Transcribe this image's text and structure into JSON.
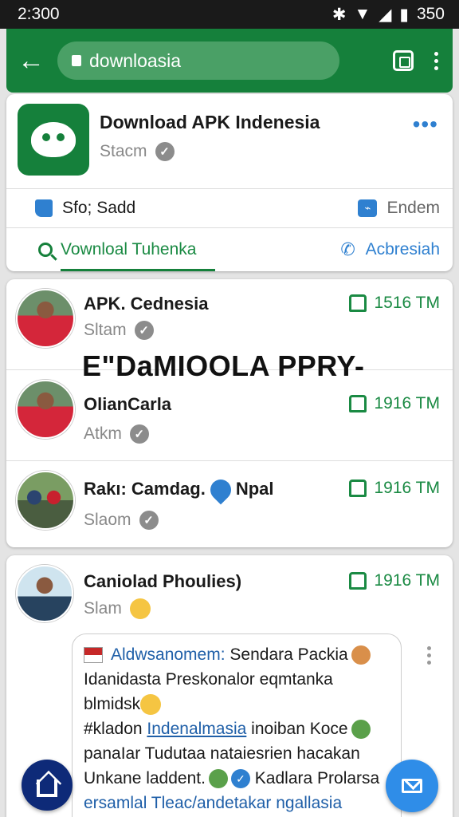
{
  "status_bar": {
    "time": "2:300",
    "battery": "350"
  },
  "browser": {
    "url": "downloasia"
  },
  "app_card": {
    "title": "Download APK Indenesia",
    "subtitle": "Stacm",
    "meta_left": "Sfo; Sadd",
    "meta_right": "Endem",
    "action_left": "Vownloal Tuhenka",
    "action_right": "Acbresiah"
  },
  "posts": [
    {
      "name": "APK. Cednesia",
      "meta": "Sltam",
      "count": "1516 TM"
    },
    {
      "name": "OlianCarla",
      "meta": "Atkm",
      "count": "1916 TM"
    },
    {
      "name_prefix": "Rakı: Camdag.",
      "name_suffix": "Npal",
      "meta": "Slaom",
      "count": "1916 TM"
    },
    {
      "name": "Caniolad Phoulies)",
      "meta": "Slam",
      "count": "1916 TM"
    }
  ],
  "overlay_text": "E\"DaMIOOLA PPRY-",
  "comment": {
    "line1_link": "Aldwsanomem:",
    "line1_text": "Sendara Packia",
    "line2": "Idanidasta Preskonalor eqmtanka",
    "line3": "blmidsk",
    "line4_prefix": "#kladon",
    "line4_link": "Indenalmasia",
    "line4_text": "inoiban Koce",
    "line5": "panaIar Tudutaa nataiesrien hacakan",
    "line6_prefix": "Unkane laddent.",
    "line6_text": "Kadlara Prolarsa",
    "line7": "ersamlal Tleac/andetakar ngallasia"
  },
  "colors": {
    "brand_green": "#15803b",
    "accent_blue": "#2f80d0",
    "fab_home": "#0e2a78",
    "fab_mail": "#2f8de8"
  }
}
